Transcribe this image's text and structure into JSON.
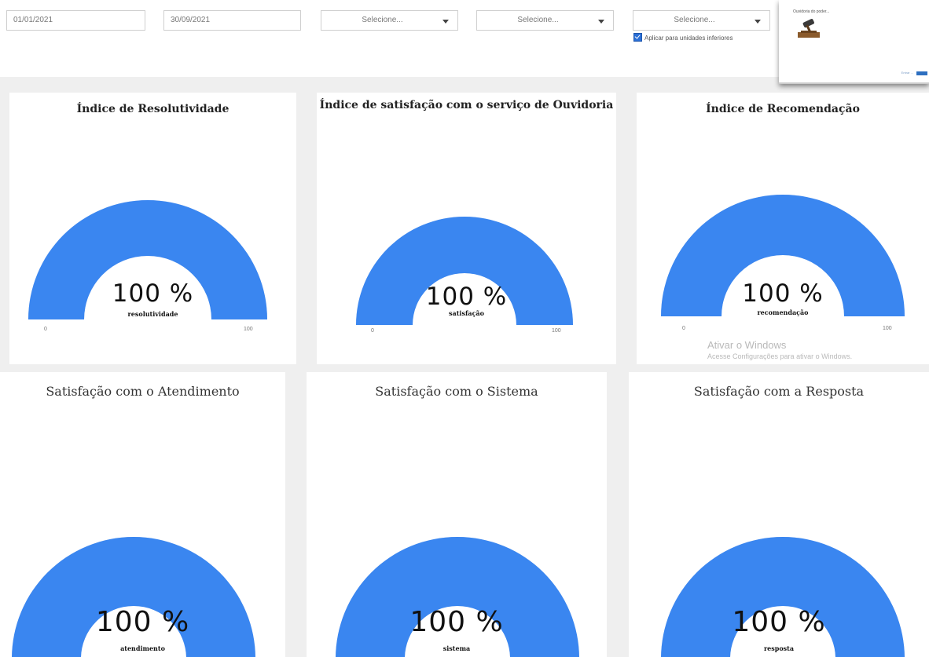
{
  "filters": {
    "date_start": "01/01/2021",
    "date_end": "30/09/2021",
    "selects": [
      "Selecione...",
      "Selecione...",
      "Selecione..."
    ],
    "apply_checkbox_label": "Aplicar para unidades inferiores",
    "apply_checked": true
  },
  "thumbnail": {
    "caption": "Ouvidoria do poder...",
    "link_text": "Entrar ..."
  },
  "gauges": [
    {
      "title": "Índice de Resolutividade",
      "value_text": "100 %",
      "sublabel": "resolutividade",
      "min": "0",
      "max": "100",
      "value": 100
    },
    {
      "title": "Índice de satisfação com o serviço de Ouvidoria",
      "value_text": "100 %",
      "sublabel": "satisfação",
      "min": "0",
      "max": "100",
      "value": 100
    },
    {
      "title": "Índice de Recomendação",
      "value_text": "100 %",
      "sublabel": "recomendação",
      "min": "0",
      "max": "100",
      "value": 100
    },
    {
      "title": "Satisfação com o Atendimento",
      "value_text": "100 %",
      "sublabel": "atendimento",
      "value": 100
    },
    {
      "title": "Satisfação com o Sistema",
      "value_text": "100 %",
      "sublabel": "sistema",
      "value": 100
    },
    {
      "title": "Satisfação com a Resposta",
      "value_text": "100 %",
      "sublabel": "resposta",
      "value": 100
    }
  ],
  "watermark": {
    "line1": "Ativar o Windows",
    "line2": "Acesse Configurações para ativar o Windows."
  },
  "colors": {
    "gauge_fill": "#3a86f0",
    "gauge_track": "#e6e6e6"
  }
}
